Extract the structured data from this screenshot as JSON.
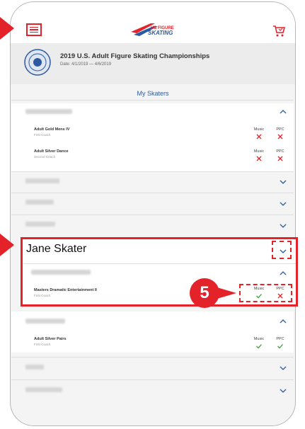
{
  "header": {
    "logo_text": "US FIGURE SKATING",
    "cart_icon": "cart-icon",
    "menu_icon": "hamburger-menu-icon"
  },
  "event": {
    "title": "2019 U.S. Adult Figure Skating Championships",
    "date": "Date: 4/1/2019 — 4/6/2019"
  },
  "section_title": "My Skaters",
  "columns": {
    "music": "Music",
    "ppc": "PPC"
  },
  "skater_groups": [
    {
      "entries": [
        {
          "name": "Adult Gold Mens IV",
          "coach": "First Coach",
          "music": "x",
          "ppc": "x"
        },
        {
          "name": "Adult Silver Dance",
          "coach": "Second Coach",
          "music": "x",
          "ppc": "x"
        }
      ]
    },
    {
      "highlighted_name": "Jane Skater",
      "entries": [
        {
          "name": "Masters Dramatic Entertainment II",
          "coach": "First Coach",
          "music": "check",
          "ppc": "x"
        }
      ]
    },
    {
      "entries": [
        {
          "name": "Adult Silver Pairs",
          "coach": "First Coach",
          "music": "check",
          "ppc": "check"
        }
      ]
    }
  ],
  "callout": {
    "number": "5"
  },
  "colors": {
    "accent_red": "#e3222a",
    "brand_blue": "#2c5aa0",
    "check_green": "#3aa03a"
  }
}
